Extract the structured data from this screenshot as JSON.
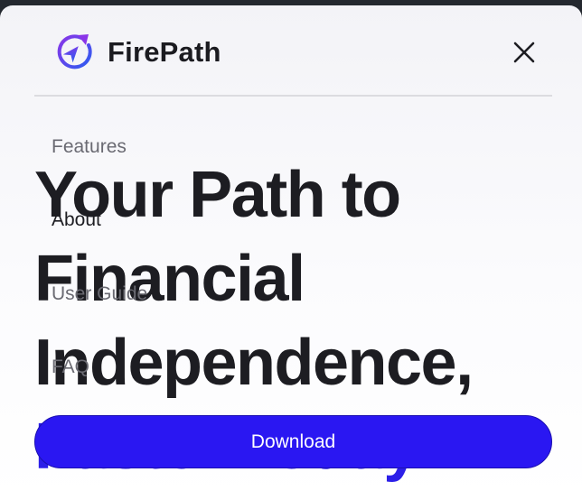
{
  "header": {
    "brand": "FirePath",
    "logo_icon": "compass-arrow-icon",
    "close_icon": "close-icon"
  },
  "hero": {
    "lines": [
      "Your Path to",
      "Financial",
      "Independence,",
      "Faster Today"
    ]
  },
  "nav": {
    "items": [
      {
        "label": "Features"
      },
      {
        "label": "About"
      },
      {
        "label": "User Guide"
      },
      {
        "label": "FAQ"
      }
    ]
  },
  "cta": {
    "download_label": "Download"
  },
  "colors": {
    "accent": "#2a17f2",
    "logo_gradient_start": "#8a35e8",
    "logo_gradient_end": "#2d5cf0",
    "text": "#1d1d22",
    "muted": "#6a6a72"
  }
}
